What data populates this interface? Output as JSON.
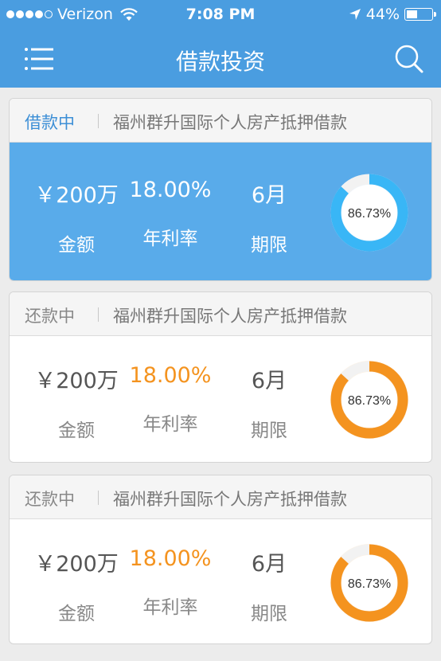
{
  "status_bar": {
    "carrier": "Verizon",
    "time": "7:08 PM",
    "battery": "44%"
  },
  "nav": {
    "title": "借款投资",
    "menu_icon": "menu-icon",
    "search_icon": "search-icon"
  },
  "colors": {
    "brand_blue": "#4a9de0",
    "card_blue": "#59abea",
    "ring_blue": "#39b6f6",
    "orange": "#f4931f"
  },
  "loans": [
    {
      "status": "借款中",
      "active": true,
      "title": "福州群升国际个人房产抵押借款",
      "amount": "￥200万",
      "amount_label": "金额",
      "rate": "18.00%",
      "rate_label": "年利率",
      "term": "6月",
      "term_label": "期限",
      "progress": "86.73%",
      "progress_value": 0.8673
    },
    {
      "status": "还款中",
      "active": false,
      "title": "福州群升国际个人房产抵押借款",
      "amount": "￥200万",
      "amount_label": "金额",
      "rate": "18.00%",
      "rate_label": "年利率",
      "term": "6月",
      "term_label": "期限",
      "progress": "86.73%",
      "progress_value": 0.8673
    },
    {
      "status": "还款中",
      "active": false,
      "title": "福州群升国际个人房产抵押借款",
      "amount": "￥200万",
      "amount_label": "金额",
      "rate": "18.00%",
      "rate_label": "年利率",
      "term": "6月",
      "term_label": "期限",
      "progress": "86.73%",
      "progress_value": 0.8673
    }
  ]
}
